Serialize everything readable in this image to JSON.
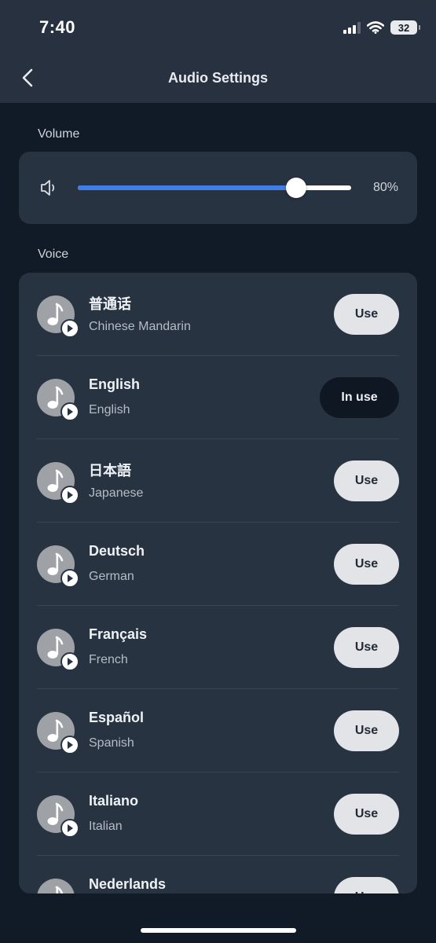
{
  "status_bar": {
    "time": "7:40",
    "battery": "32"
  },
  "header": {
    "title": "Audio Settings"
  },
  "volume": {
    "section_label": "Volume",
    "level_percent": 80,
    "value_text": "80%"
  },
  "voice": {
    "section_label": "Voice",
    "items": [
      {
        "name": "普通话",
        "subtitle": "Chinese Mandarin",
        "button": "Use",
        "active": false
      },
      {
        "name": "English",
        "subtitle": "English",
        "button": "In use",
        "active": true
      },
      {
        "name": "日本語",
        "subtitle": "Japanese",
        "button": "Use",
        "active": false
      },
      {
        "name": "Deutsch",
        "subtitle": "German",
        "button": "Use",
        "active": false
      },
      {
        "name": "Français",
        "subtitle": "French",
        "button": "Use",
        "active": false
      },
      {
        "name": "Español",
        "subtitle": "Spanish",
        "button": "Use",
        "active": false
      },
      {
        "name": "Italiano",
        "subtitle": "Italian",
        "button": "Use",
        "active": false
      },
      {
        "name": "Nederlands",
        "subtitle": "",
        "button": "Use",
        "active": false
      }
    ]
  },
  "colors": {
    "accent": "#3f7de8",
    "background": "#111a27",
    "card": "#283341",
    "header": "#27313f"
  }
}
